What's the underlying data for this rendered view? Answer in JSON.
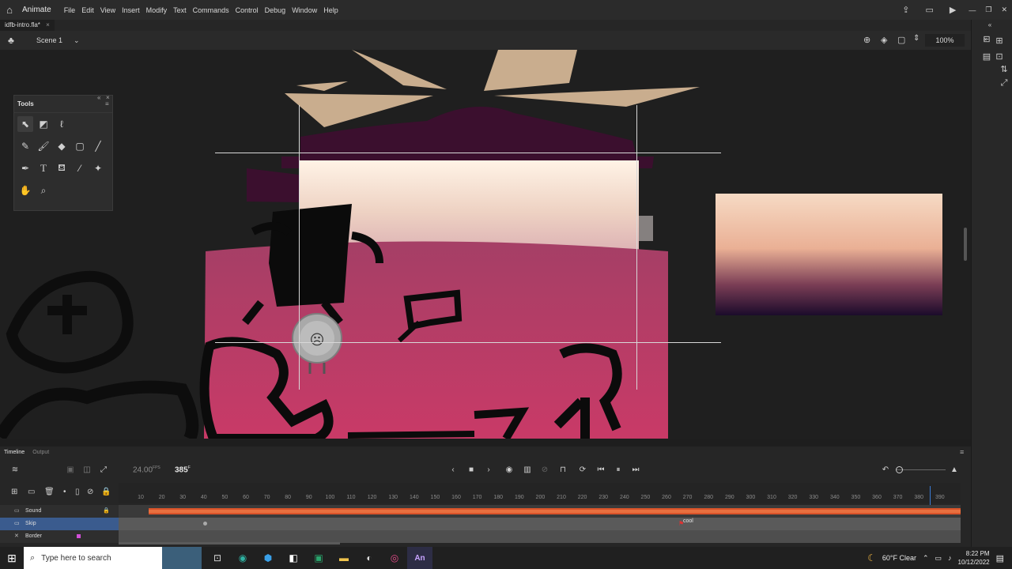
{
  "app": {
    "name": "Animate"
  },
  "menu": [
    "File",
    "Edit",
    "View",
    "Insert",
    "Modify",
    "Text",
    "Commands",
    "Control",
    "Debug",
    "Window",
    "Help"
  ],
  "document_tab": {
    "label": "idfb-intro.fla*"
  },
  "scene": {
    "label": "Scene 1"
  },
  "zoom": {
    "value": "100%"
  },
  "tools_panel": {
    "title": "Tools"
  },
  "timeline": {
    "tabs": [
      "Timeline",
      "Output"
    ],
    "fps": "24.00",
    "fps_unit": "FPS",
    "current_frame": "385",
    "frame_unit": "F",
    "ruler_ticks": [
      "10",
      "20",
      "30",
      "40",
      "50",
      "60",
      "70",
      "80",
      "90",
      "100",
      "110",
      "120",
      "130",
      "140",
      "150",
      "160",
      "170",
      "180",
      "190",
      "200",
      "210",
      "220",
      "230",
      "240",
      "250",
      "260",
      "270",
      "280",
      "290",
      "300",
      "310",
      "320",
      "330",
      "340",
      "350",
      "360",
      "370",
      "380",
      "390"
    ],
    "layers": [
      {
        "name": "Sound"
      },
      {
        "name": "Skip"
      },
      {
        "name": "Border"
      }
    ],
    "frame_label": "cool"
  },
  "taskbar": {
    "search_placeholder": "Type here to search",
    "weather": "60°F Clear",
    "time": "8:22 PM",
    "date": "10/12/2022"
  },
  "colors": {
    "accent": "#3a5b8e",
    "stage_pink": "#c43a67",
    "sky_top": "#f3d2b6",
    "sky_bottom": "#1b0b2b",
    "sound_wave": "#d9532a"
  }
}
